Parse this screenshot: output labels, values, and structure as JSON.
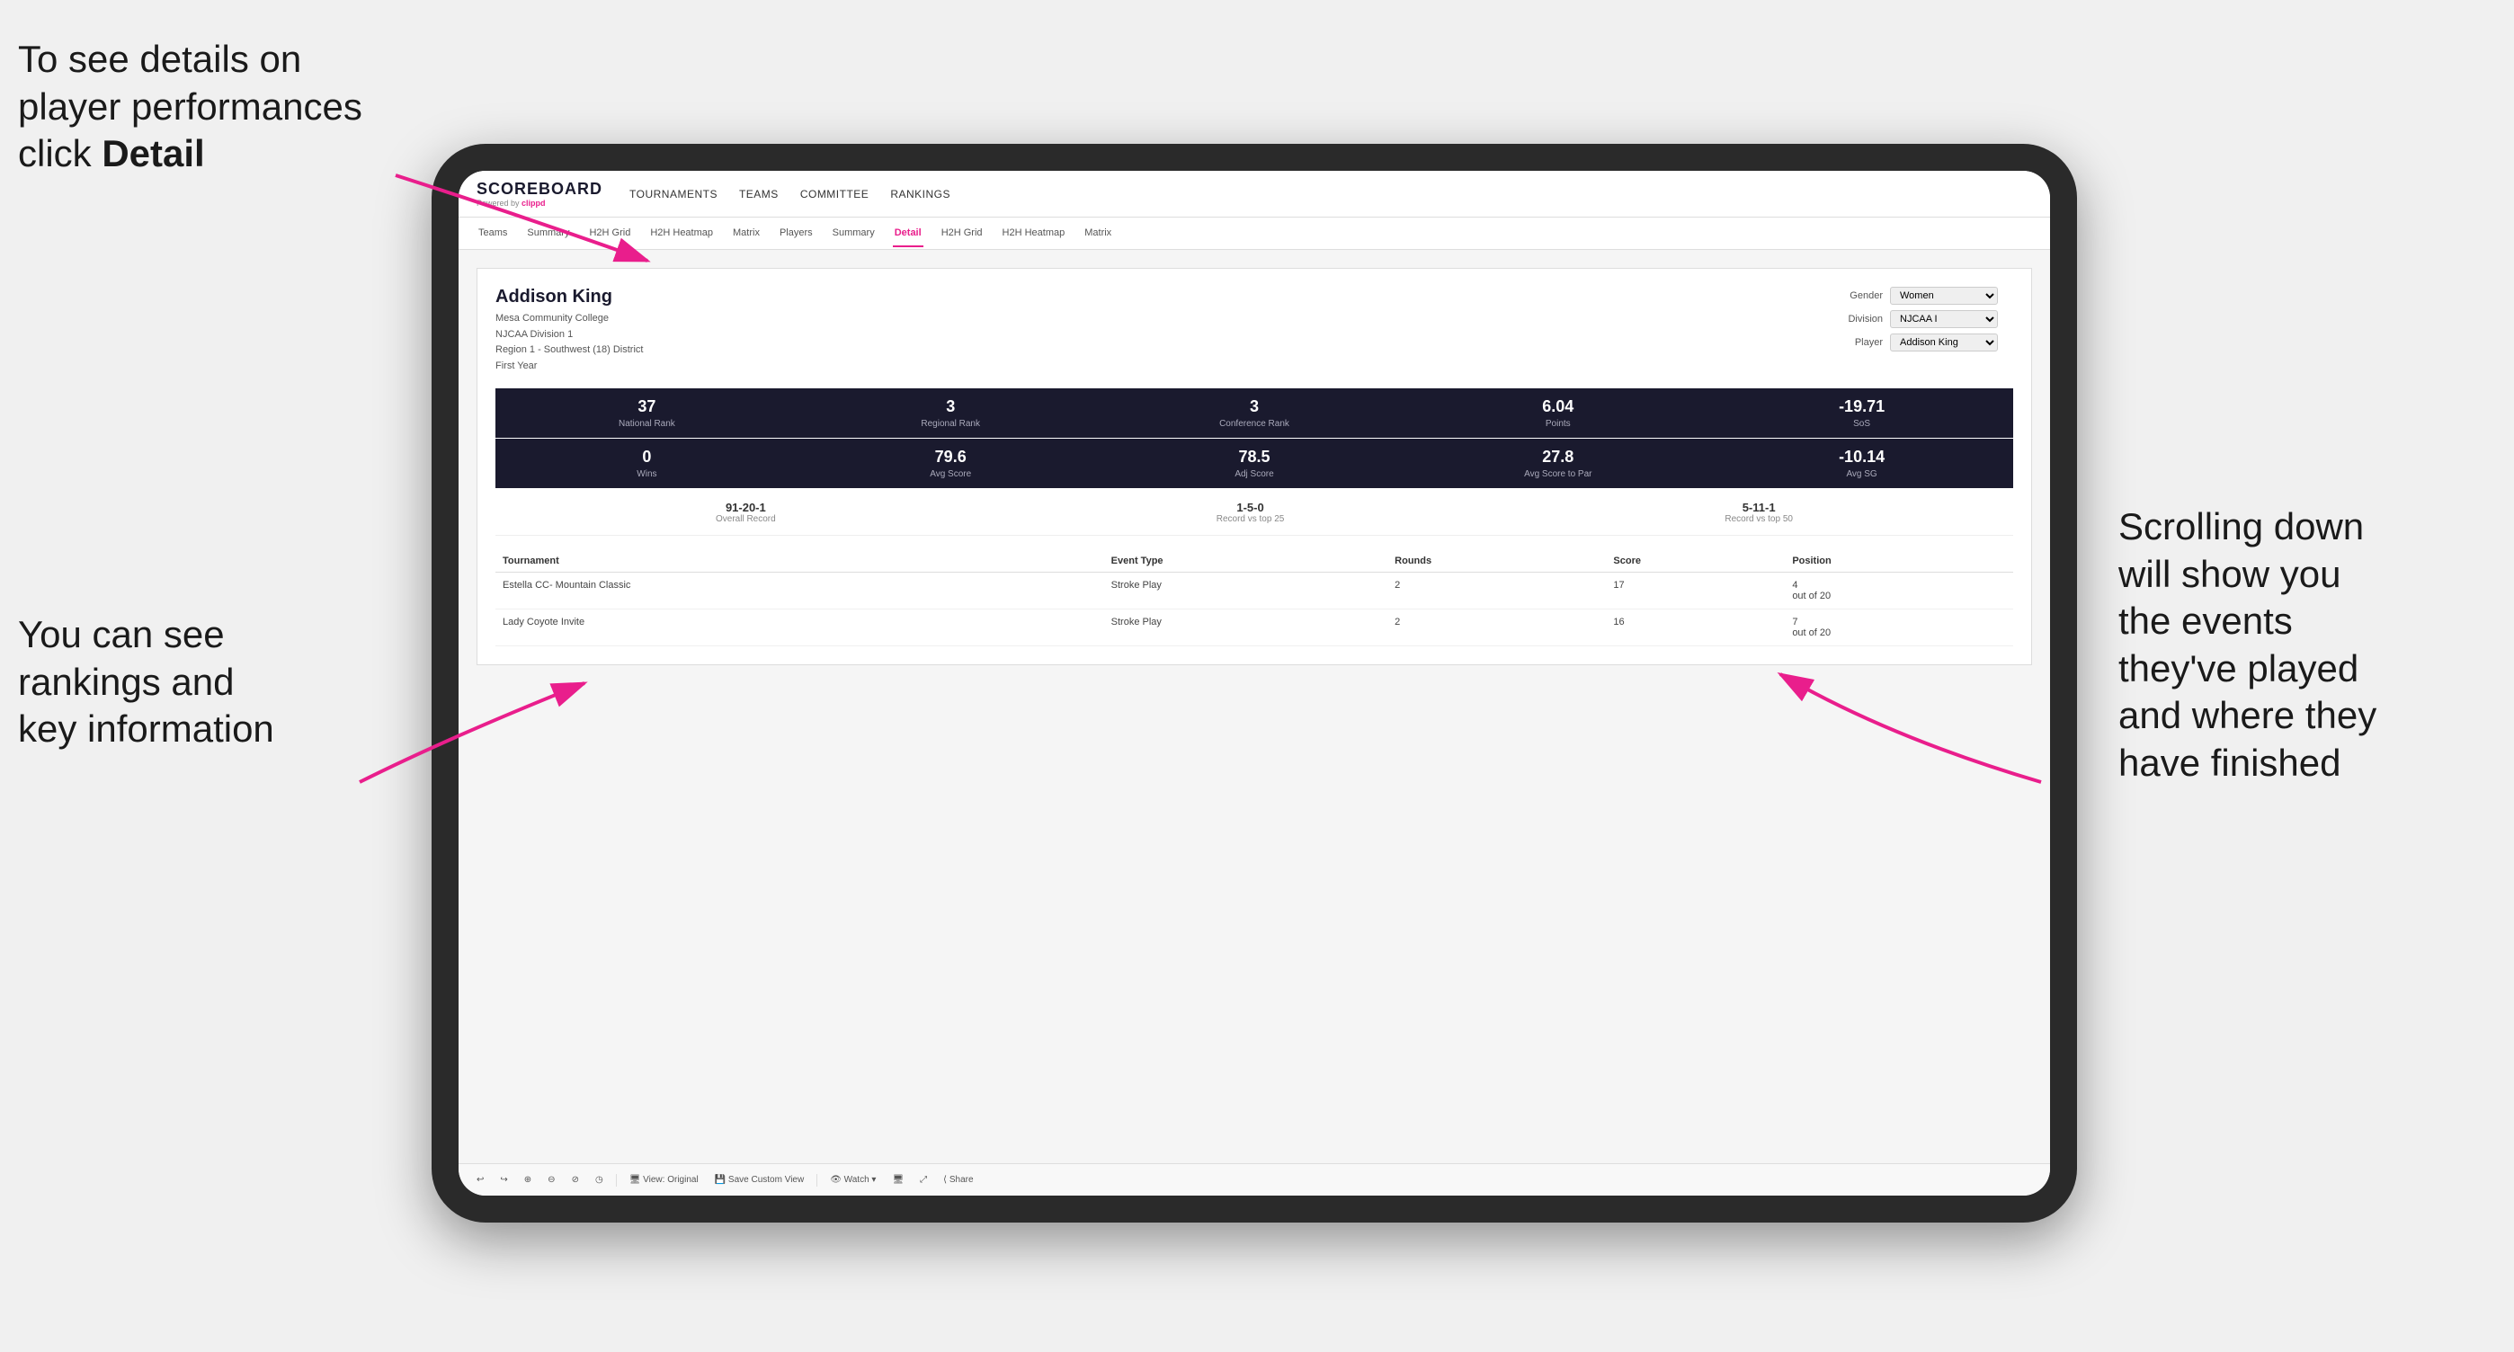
{
  "annotations": {
    "top_left": {
      "line1": "To see details on",
      "line2": "player performances",
      "line3": "click ",
      "line3_bold": "Detail"
    },
    "bottom_left": {
      "line1": "You can see",
      "line2": "rankings and",
      "line3": "key information"
    },
    "right": {
      "line1": "Scrolling down",
      "line2": "will show you",
      "line3": "the events",
      "line4": "they've played",
      "line5": "and where they",
      "line6": "have finished"
    }
  },
  "nav": {
    "logo": "SCOREBOARD",
    "powered_by": "Powered by ",
    "clippd": "clippd",
    "items": [
      "TOURNAMENTS",
      "TEAMS",
      "COMMITTEE",
      "RANKINGS"
    ]
  },
  "sub_nav": {
    "items": [
      "Teams",
      "Summary",
      "H2H Grid",
      "H2H Heatmap",
      "Matrix",
      "Players",
      "Summary",
      "Detail",
      "H2H Grid",
      "H2H Heatmap",
      "Matrix"
    ],
    "active": "Detail"
  },
  "player": {
    "name": "Addison King",
    "school": "Mesa Community College",
    "division": "NJCAA Division 1",
    "region": "Region 1 - Southwest (18) District",
    "year": "First Year"
  },
  "filters": {
    "gender_label": "Gender",
    "gender_value": "Women",
    "division_label": "Division",
    "division_value": "NJCAA I",
    "player_label": "Player",
    "player_value": "Addison King"
  },
  "stats_row1": [
    {
      "value": "37",
      "label": "National Rank"
    },
    {
      "value": "3",
      "label": "Regional Rank"
    },
    {
      "value": "3",
      "label": "Conference Rank"
    },
    {
      "value": "6.04",
      "label": "Points"
    },
    {
      "value": "-19.71",
      "label": "SoS"
    }
  ],
  "stats_row2": [
    {
      "value": "0",
      "label": "Wins"
    },
    {
      "value": "79.6",
      "label": "Avg Score"
    },
    {
      "value": "78.5",
      "label": "Adj Score"
    },
    {
      "value": "27.8",
      "label": "Avg Score to Par"
    },
    {
      "value": "-10.14",
      "label": "Avg SG"
    }
  ],
  "records": [
    {
      "value": "91-20-1",
      "label": "Overall Record"
    },
    {
      "value": "1-5-0",
      "label": "Record vs top 25"
    },
    {
      "value": "5-11-1",
      "label": "Record vs top 50"
    }
  ],
  "table": {
    "headers": [
      "Tournament",
      "Event Type",
      "Rounds",
      "Score",
      "Position"
    ],
    "rows": [
      {
        "tournament": "Estella CC- Mountain Classic",
        "event_type": "Stroke Play",
        "rounds": "2",
        "score": "17",
        "position": "4\nout of 20"
      },
      {
        "tournament": "Lady Coyote Invite",
        "event_type": "Stroke Play",
        "rounds": "2",
        "score": "16",
        "position": "7\nout of 20"
      }
    ]
  },
  "toolbar": {
    "buttons": [
      "↩",
      "↪",
      "⊕",
      "⊖",
      "⊘",
      "◷",
      "View: Original",
      "Save Custom View",
      "Watch ▾",
      "🖥",
      "⤢",
      "Share"
    ]
  }
}
